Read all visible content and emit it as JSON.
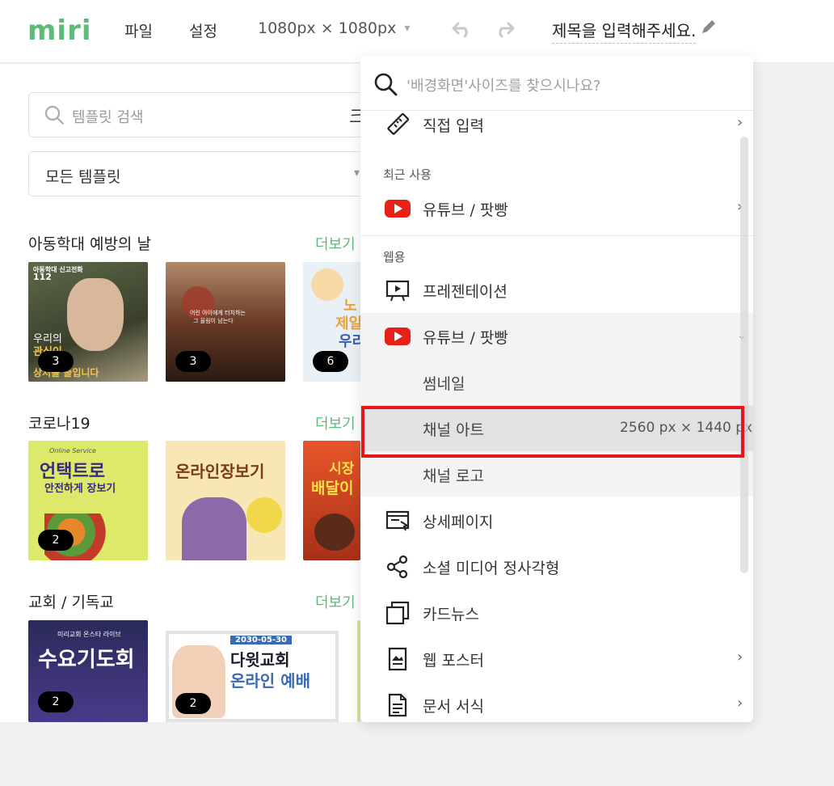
{
  "app": {
    "logo": "miri"
  },
  "topbar": {
    "menu": [
      "파일",
      "설정"
    ],
    "canvas_size": "1080px × 1080px",
    "title": "제목을 입력해주세요."
  },
  "left": {
    "search_placeholder": "템플릿 검색",
    "search_extra": "크",
    "filter_value": "모든 템플릿",
    "sections": [
      {
        "title": "아동학대 예방의 날",
        "more": "더보기",
        "thumbs": [
          {
            "badge": "3",
            "lines": [
              "아동학대 신고전화",
              "112",
              "우리의",
              "관심이",
              "상처를 줄입니다"
            ]
          },
          {
            "badge": "3",
            "lines": [
              "어린 아이에게 터치하는",
              "그 울림이 남는다"
            ]
          },
          {
            "badge": "6",
            "lines": [
              "노",
              "제일",
              "우리"
            ]
          }
        ]
      },
      {
        "title": "코로나19",
        "more": "더보기",
        "thumbs": [
          {
            "badge": "2",
            "lines": [
              "Online Service",
              "언택트로",
              "안전하게 장보기"
            ]
          },
          {
            "badge": "",
            "lines": [
              "온라인장보기"
            ]
          },
          {
            "badge": "",
            "lines": [
              "시장",
              "배달이"
            ]
          }
        ]
      },
      {
        "title": "교회 / 기독교",
        "more": "더보기",
        "thumbs": [
          {
            "badge": "2",
            "lines": [
              "미리교회 온스타 라이브",
              "수요기도회"
            ]
          },
          {
            "badge": "2",
            "lines": [
              "2030-05-30",
              "다윗교회",
              "온라인 예배"
            ]
          }
        ]
      }
    ]
  },
  "dropdown": {
    "search_placeholder": "'배경화면'사이즈를 찾으시나요?",
    "direct_input": "직접 입력",
    "recent_label": "최근 사용",
    "recent_item": "유튜브 / 팟빵",
    "web_label": "웹용",
    "items": {
      "presentation": "프레젠테이션",
      "youtube": "유튜브 / 팟빵",
      "thumbnail": "썸네일",
      "channel_art": "채널 아트",
      "channel_art_size": "2560 px × 1440 px",
      "channel_logo": "채널 로고",
      "detail_page": "상세페이지",
      "social_square": "소셜 미디어 정사각형",
      "card_news": "카드뉴스",
      "web_poster": "웹 포스터",
      "document": "문서 서식"
    }
  }
}
